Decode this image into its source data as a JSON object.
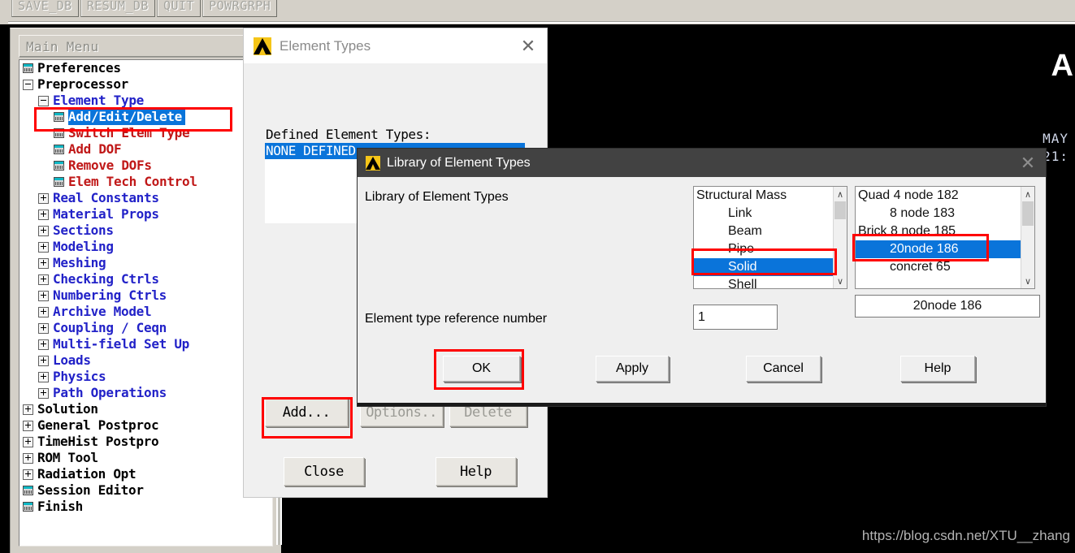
{
  "toolbar": {
    "buttons": [
      {
        "label": "SAVE_DB",
        "name": "save-db-button"
      },
      {
        "label": "RESUM_DB",
        "name": "resum-db-button"
      },
      {
        "label": "QUIT",
        "name": "quit-button"
      },
      {
        "label": "POWRGRPH",
        "name": "powrgrph-button"
      }
    ]
  },
  "main_menu": {
    "title": "Main Menu",
    "tree": [
      {
        "label": "Preferences",
        "indent": 0,
        "marker": "icon",
        "color": "black"
      },
      {
        "label": "Preprocessor",
        "indent": 0,
        "marker": "minus",
        "color": "black"
      },
      {
        "label": "Element Type",
        "indent": 1,
        "marker": "minus",
        "color": "blue"
      },
      {
        "label": "Add/Edit/Delete",
        "indent": 2,
        "marker": "icon",
        "color": "blue",
        "selected": true
      },
      {
        "label": "Switch Elem Type",
        "indent": 2,
        "marker": "icon",
        "color": "red"
      },
      {
        "label": "Add DOF",
        "indent": 2,
        "marker": "icon",
        "color": "red"
      },
      {
        "label": "Remove DOFs",
        "indent": 2,
        "marker": "icon",
        "color": "red"
      },
      {
        "label": "Elem Tech Control",
        "indent": 2,
        "marker": "icon",
        "color": "red"
      },
      {
        "label": "Real Constants",
        "indent": 1,
        "marker": "plus",
        "color": "blue"
      },
      {
        "label": "Material Props",
        "indent": 1,
        "marker": "plus",
        "color": "blue"
      },
      {
        "label": "Sections",
        "indent": 1,
        "marker": "plus",
        "color": "blue"
      },
      {
        "label": "Modeling",
        "indent": 1,
        "marker": "plus",
        "color": "blue"
      },
      {
        "label": "Meshing",
        "indent": 1,
        "marker": "plus",
        "color": "blue"
      },
      {
        "label": "Checking Ctrls",
        "indent": 1,
        "marker": "plus",
        "color": "blue"
      },
      {
        "label": "Numbering Ctrls",
        "indent": 1,
        "marker": "plus",
        "color": "blue"
      },
      {
        "label": "Archive Model",
        "indent": 1,
        "marker": "plus",
        "color": "blue"
      },
      {
        "label": "Coupling / Ceqn",
        "indent": 1,
        "marker": "plus",
        "color": "blue"
      },
      {
        "label": "Multi-field Set Up",
        "indent": 1,
        "marker": "plus",
        "color": "blue"
      },
      {
        "label": "Loads",
        "indent": 1,
        "marker": "plus",
        "color": "blue"
      },
      {
        "label": "Physics",
        "indent": 1,
        "marker": "plus",
        "color": "blue"
      },
      {
        "label": "Path Operations",
        "indent": 1,
        "marker": "plus",
        "color": "blue"
      },
      {
        "label": "Solution",
        "indent": 0,
        "marker": "plus",
        "color": "black"
      },
      {
        "label": "General Postproc",
        "indent": 0,
        "marker": "plus",
        "color": "black"
      },
      {
        "label": "TimeHist Postpro",
        "indent": 0,
        "marker": "plus",
        "color": "black"
      },
      {
        "label": "ROM Tool",
        "indent": 0,
        "marker": "plus",
        "color": "black"
      },
      {
        "label": "Radiation Opt",
        "indent": 0,
        "marker": "plus",
        "color": "black"
      },
      {
        "label": "Session Editor",
        "indent": 0,
        "marker": "icon",
        "color": "black"
      },
      {
        "label": "Finish",
        "indent": 0,
        "marker": "icon",
        "color": "black"
      }
    ]
  },
  "element_types_dialog": {
    "title": "Element Types",
    "close_glyph": "✕",
    "defined_label": "Defined Element Types:",
    "list_selected": "NONE DEFINED",
    "buttons": {
      "add": "Add...",
      "options": "Options..",
      "delete": "Delete",
      "close": "Close",
      "help": "Help"
    }
  },
  "library_dialog": {
    "title": "Library of Element Types",
    "close_glyph": "✕",
    "section_label": "Library of Element Types",
    "category_list": [
      {
        "label": "Structural Mass",
        "indent": 0,
        "selected": false
      },
      {
        "label": "Link",
        "indent": 1,
        "selected": false
      },
      {
        "label": "Beam",
        "indent": 1,
        "selected": false
      },
      {
        "label": "Pipe",
        "indent": 1,
        "selected": false
      },
      {
        "label": "Solid",
        "indent": 1,
        "selected": true
      },
      {
        "label": "Shell",
        "indent": 1,
        "selected": false
      }
    ],
    "type_list": [
      {
        "label": "Quad  4 node 182",
        "indent": 0,
        "selected": false
      },
      {
        "label": "8 node 183",
        "indent": 1,
        "selected": false
      },
      {
        "label": "Brick 8 node 185",
        "indent": 0,
        "selected": false
      },
      {
        "label": "20node 186",
        "indent": 1,
        "selected": true
      },
      {
        "label": "concret 65",
        "indent": 1,
        "selected": false
      }
    ],
    "selected_type": "20node 186",
    "ref_number_label": "Element type reference number",
    "ref_number_value": "1",
    "buttons": {
      "ok": "OK",
      "apply": "Apply",
      "cancel": "Cancel",
      "help": "Help"
    },
    "scroll_glyph_up": "∧",
    "scroll_glyph_down": "∨"
  },
  "graphics": {
    "brand_letter": "A",
    "date_line1": "MAY",
    "date_line2": "21:",
    "watermark": "https://blog.csdn.net/XTU__zhang"
  },
  "colors": {
    "selection_blue": "#0a74da",
    "highlight_red": "#ff0000",
    "tree_blue": "#2222c8",
    "tree_red": "#c01818",
    "ansys_yellow": "#f5c518"
  }
}
